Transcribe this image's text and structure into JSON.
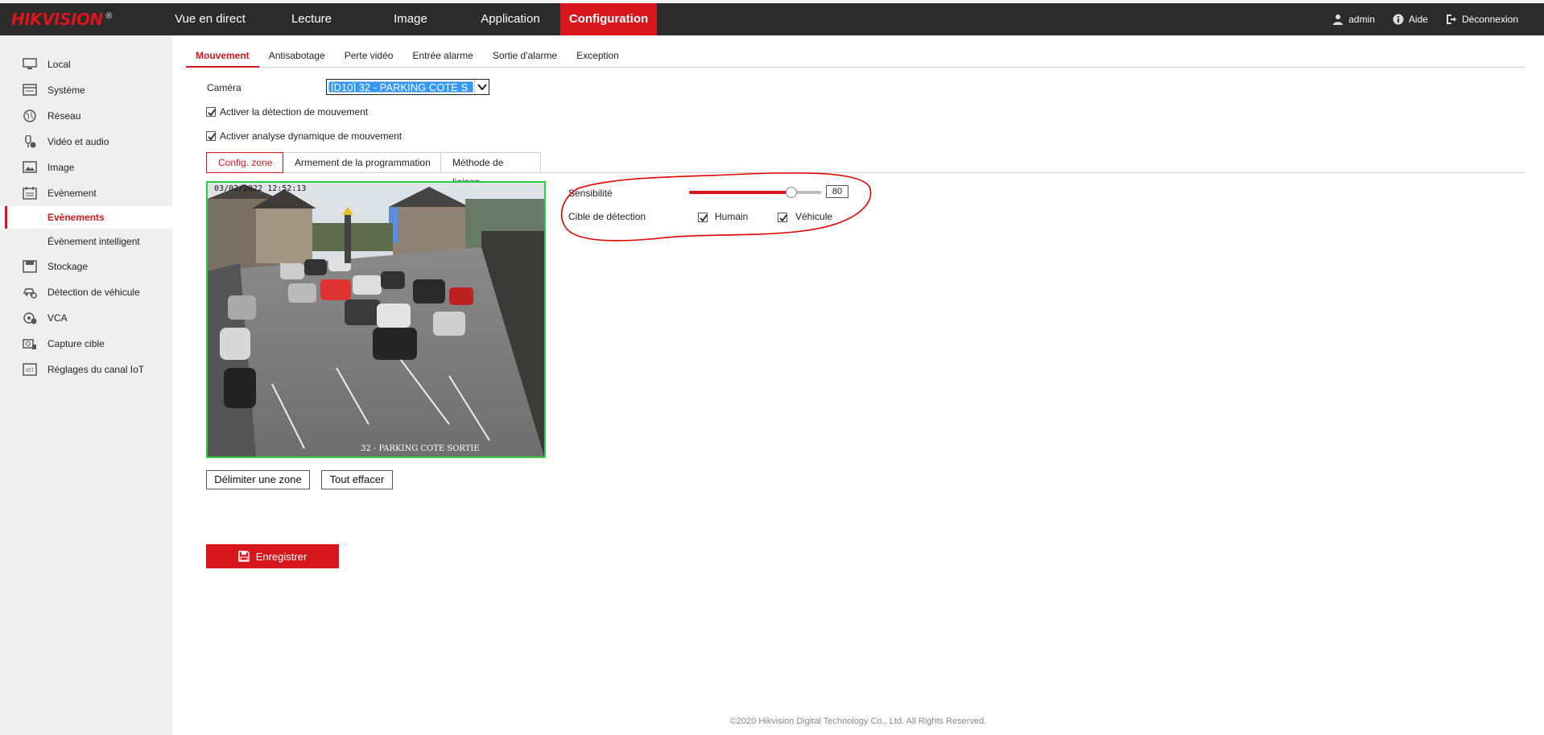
{
  "header": {
    "logo": "HIKVISION",
    "logo_reg": "®",
    "nav": [
      {
        "label": "Vue en direct"
      },
      {
        "label": "Lecture"
      },
      {
        "label": "Image"
      },
      {
        "label": "Application"
      },
      {
        "label": "Configuration"
      }
    ],
    "user": "admin",
    "help": "Aide",
    "logout": "Déconnexion"
  },
  "sidebar": {
    "items": [
      {
        "label": "Local",
        "icon": "monitor-icon"
      },
      {
        "label": "Système",
        "icon": "system-icon"
      },
      {
        "label": "Réseau",
        "icon": "globe-icon"
      },
      {
        "label": "Vidéo et audio",
        "icon": "mic-icon"
      },
      {
        "label": "Image",
        "icon": "image-icon"
      },
      {
        "label": "Evènement",
        "icon": "calendar-icon"
      },
      {
        "label": "Evènements"
      },
      {
        "label": "Évènement intelligent"
      },
      {
        "label": "Stockage",
        "icon": "storage-icon"
      },
      {
        "label": "Détection de véhicule",
        "icon": "vehicle-icon"
      },
      {
        "label": "VCA",
        "icon": "vca-icon"
      },
      {
        "label": "Capture cible",
        "icon": "capture-icon"
      },
      {
        "label": "Réglages du canal IoT",
        "icon": "iot-icon"
      }
    ]
  },
  "tabs": [
    {
      "label": "Mouvement"
    },
    {
      "label": "Antisabotage"
    },
    {
      "label": "Perte vidéo"
    },
    {
      "label": "Entrée alarme"
    },
    {
      "label": "Sortie d'alarme"
    },
    {
      "label": "Exception"
    }
  ],
  "camera": {
    "label": "Caméra",
    "selected": "[D10] 32 - PARKING COTE S"
  },
  "options": {
    "enable_motion": "Activer la détection de mouvement",
    "enable_dynamic": "Activer analyse dynamique de mouvement"
  },
  "subtabs": [
    {
      "label": "Config. zone"
    },
    {
      "label": "Armement de la programmation"
    },
    {
      "label": "Méthode de liaison"
    }
  ],
  "video": {
    "timestamp": "03/02/2022 12:52:13",
    "camera_name": "32 - PARKING COTE SORTIE"
  },
  "settings": {
    "sensitivity_label": "Sensibilité",
    "sensitivity_value": "80",
    "sensitivity_fraction": 0.8,
    "target_label": "Cible de détection",
    "human_label": "Humain",
    "vehicle_label": "Véhicule"
  },
  "buttons": {
    "draw_zone": "Délimiter une zone",
    "clear_all": "Tout effacer",
    "save": "Enregistrer"
  },
  "footer": "©2020 Hikvision Digital Technology Co., Ltd. All Rights Reserved.",
  "colors": {
    "accent": "#d7161e",
    "header_bg": "#2b2b2b",
    "sidebar_bg": "#efefef",
    "annotation": "#e00000"
  }
}
